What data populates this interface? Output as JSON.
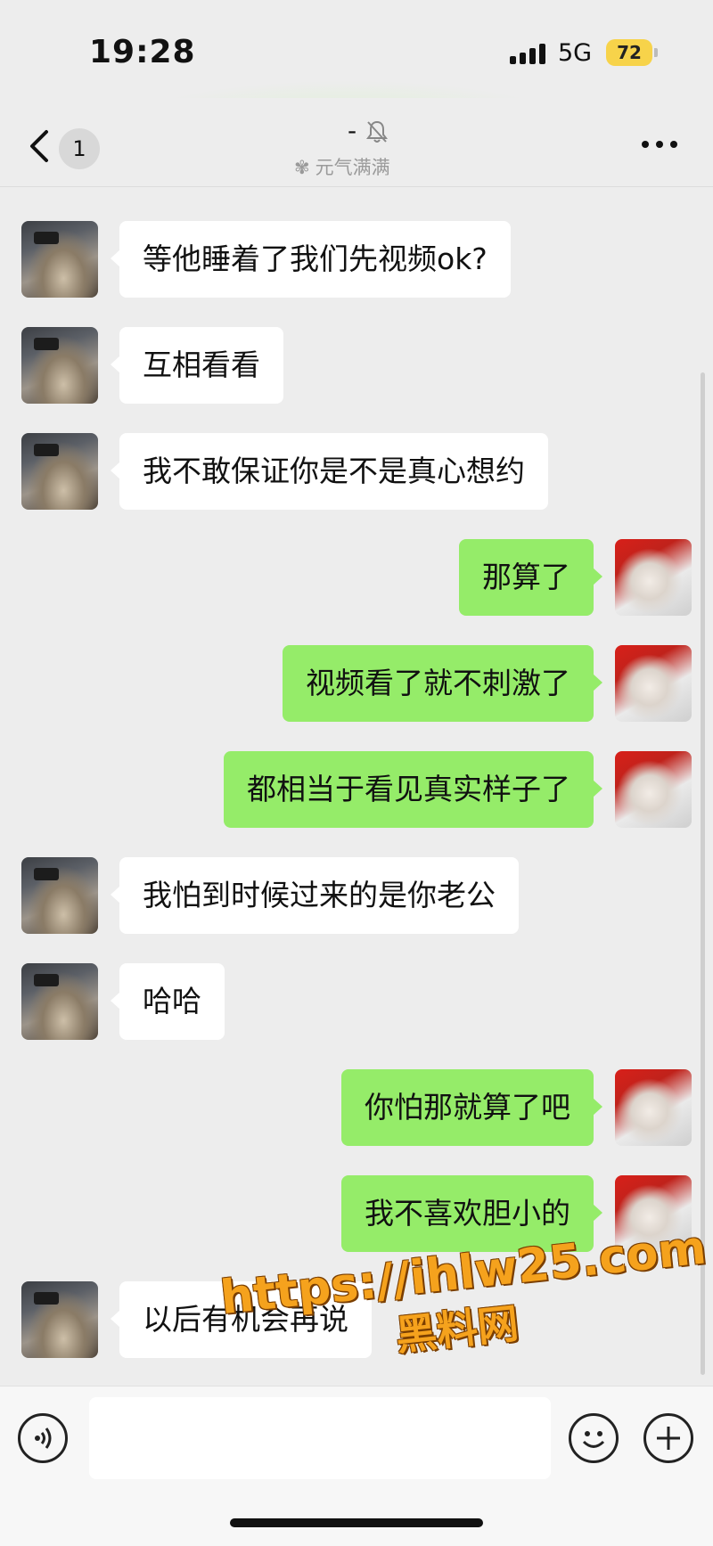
{
  "status_bar": {
    "time": "19:28",
    "network": "5G",
    "battery": "72"
  },
  "nav": {
    "unread_count": "1",
    "title": "-",
    "subtitle": "元气满满",
    "icons": [
      "chevron-left-icon",
      "bell-off-icon",
      "more-icon"
    ]
  },
  "messages": [
    {
      "side": "them",
      "text": "等他睡着了我们先视频ok?"
    },
    {
      "side": "them",
      "text": "互相看看"
    },
    {
      "side": "them",
      "text": "我不敢保证你是不是真心想约"
    },
    {
      "side": "me",
      "text": "那算了"
    },
    {
      "side": "me",
      "text": "视频看了就不刺激了"
    },
    {
      "side": "me",
      "text": "都相当于看见真实样子了"
    },
    {
      "side": "them",
      "text": "我怕到时候过来的是你老公"
    },
    {
      "side": "them",
      "text": "哈哈"
    },
    {
      "side": "me",
      "text": "你怕那就算了吧"
    },
    {
      "side": "me",
      "text": "我不喜欢胆小的"
    },
    {
      "side": "them",
      "text": "以后有机会再说"
    }
  ],
  "watermark": {
    "line1": "https://ihlw25.com",
    "line2": "黑料网"
  },
  "input_bar": {
    "value": "",
    "icons": [
      "voice-icon",
      "emoji-icon",
      "plus-icon"
    ]
  },
  "colors": {
    "background": "#ededed",
    "my_bubble": "#95ec69",
    "their_bubble": "#ffffff",
    "battery": "#f7d34a"
  }
}
